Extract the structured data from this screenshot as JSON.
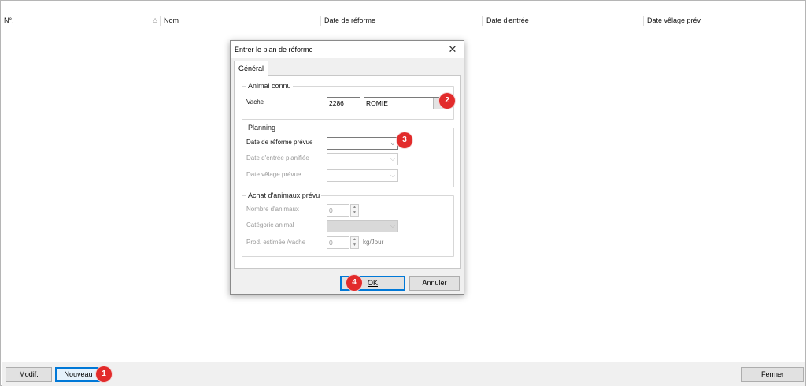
{
  "list": {
    "columns": [
      "N°.",
      "Nom",
      "Date de réforme",
      "Date d'entrée",
      "Date vêlage prév"
    ],
    "sort_icon": "sort-ascending-icon"
  },
  "bottom_bar": {
    "modif_label": "Modif.",
    "nouveau_label": "Nouveau",
    "fermer_label": "Fermer"
  },
  "dialog": {
    "title": "Entrer le plan de réforme",
    "close_icon": "close-icon",
    "tab_label": "Général",
    "animal_connu": {
      "legend": "Animal connu",
      "vache_label": "Vache",
      "vache_number": "2286",
      "vache_name": "ROMIE"
    },
    "planning": {
      "legend": "Planning",
      "date_reforme_label": "Date de réforme prévue",
      "date_entree_label": "Date d'entrée planifiée",
      "date_velage_label": "Date vêlage prévue"
    },
    "achat": {
      "legend": "Achat d'animaux prévu",
      "nombre_label": "Nombre d'animaux",
      "nombre_value": "0",
      "categorie_label": "Catégorie animal",
      "prod_label": "Prod. estimée /vache",
      "prod_value": "0",
      "prod_unit": "kg/Jour"
    },
    "ok_label": "OK",
    "annuler_label": "Annuler"
  },
  "markers": [
    "1",
    "2",
    "3",
    "4"
  ],
  "colors": {
    "marker": "#e22b2b",
    "focus_blue": "#0078d7"
  }
}
